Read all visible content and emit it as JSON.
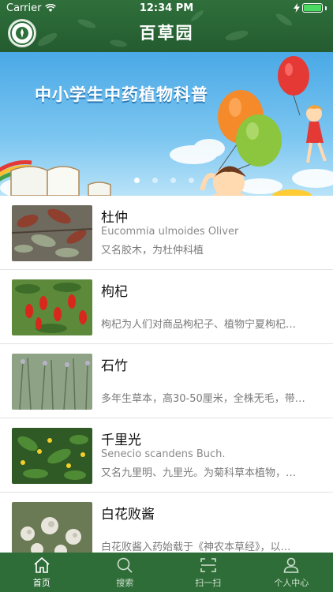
{
  "status_bar": {
    "carrier": "Carrier",
    "time": "12:34 PM"
  },
  "header": {
    "title": "百草园"
  },
  "banner": {
    "headline": "中小学生中药植物科普",
    "slide_count": 4,
    "active_slide": 1
  },
  "plants": [
    {
      "name": "杜仲",
      "latin": "Eucommia ulmoides Oliver",
      "desc": "又名胶木，为杜仲科植"
    },
    {
      "name": "枸杞",
      "latin": "",
      "desc": "枸杞为人们对商品枸杞子、植物宁夏枸杞…"
    },
    {
      "name": "石竹",
      "latin": "",
      "desc": "多年生草本，高30-50厘米，全株无毛，带…"
    },
    {
      "name": "千里光",
      "latin": "Senecio scandens Buch.",
      "desc": "又名九里明、九里光。为菊科草本植物，…"
    },
    {
      "name": "白花败酱",
      "latin": "",
      "desc": "白花败酱入药始载于《神农本草经》，以…"
    }
  ],
  "tabs": [
    {
      "label": "首页",
      "icon": "home-icon",
      "active": true
    },
    {
      "label": "搜索",
      "icon": "search-icon",
      "active": false
    },
    {
      "label": "扫一扫",
      "icon": "scan-icon",
      "active": false
    },
    {
      "label": "个人中心",
      "icon": "person-icon",
      "active": false
    }
  ],
  "colors": {
    "header_green": "#2f6f3b",
    "tabbar_green": "#2e6d38",
    "banner_sky": "#4aa9e6"
  }
}
